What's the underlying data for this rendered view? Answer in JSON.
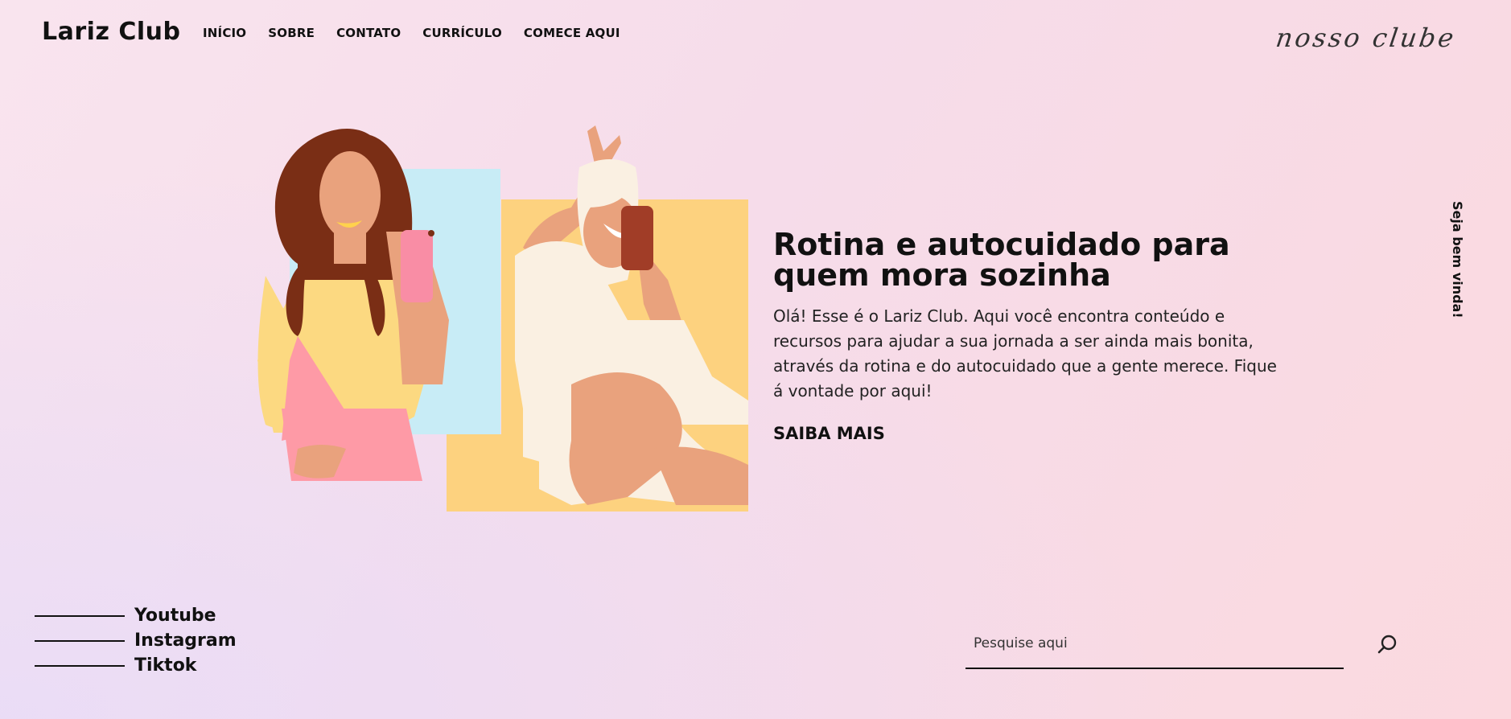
{
  "header": {
    "logo": "Lariz Club",
    "nav": [
      "INÍCIO",
      "SOBRE",
      "CONTATO",
      "CURRÍCULO",
      "COMECE AQUI"
    ],
    "script_link": "nosso clube"
  },
  "side_text": "Seja bem vinda!",
  "hero": {
    "title": "Rotina e autocuidado para quem mora sozinha",
    "description": "Olá! Esse é o Lariz Club. Aqui você encontra conteúdo e recursos para ajudar a sua jornada a ser ainda mais bonita, através da rotina e do autocuidado que a gente merece. Fique á vontade por aqui!",
    "cta": "SAIBA MAIS"
  },
  "socials": [
    "Youtube",
    "Instagram",
    "Tiktok"
  ],
  "search": {
    "placeholder": "Pesquise aqui",
    "icon": "search-icon"
  },
  "colors": {
    "illustration_blue": "#c8ecf6",
    "illustration_yellow": "#fdd27f",
    "hair": "#7a2e15",
    "skin": "#e9a27d",
    "top": "#fcd981",
    "skirt": "#fe9aa6",
    "robe": "#faf0e2"
  }
}
